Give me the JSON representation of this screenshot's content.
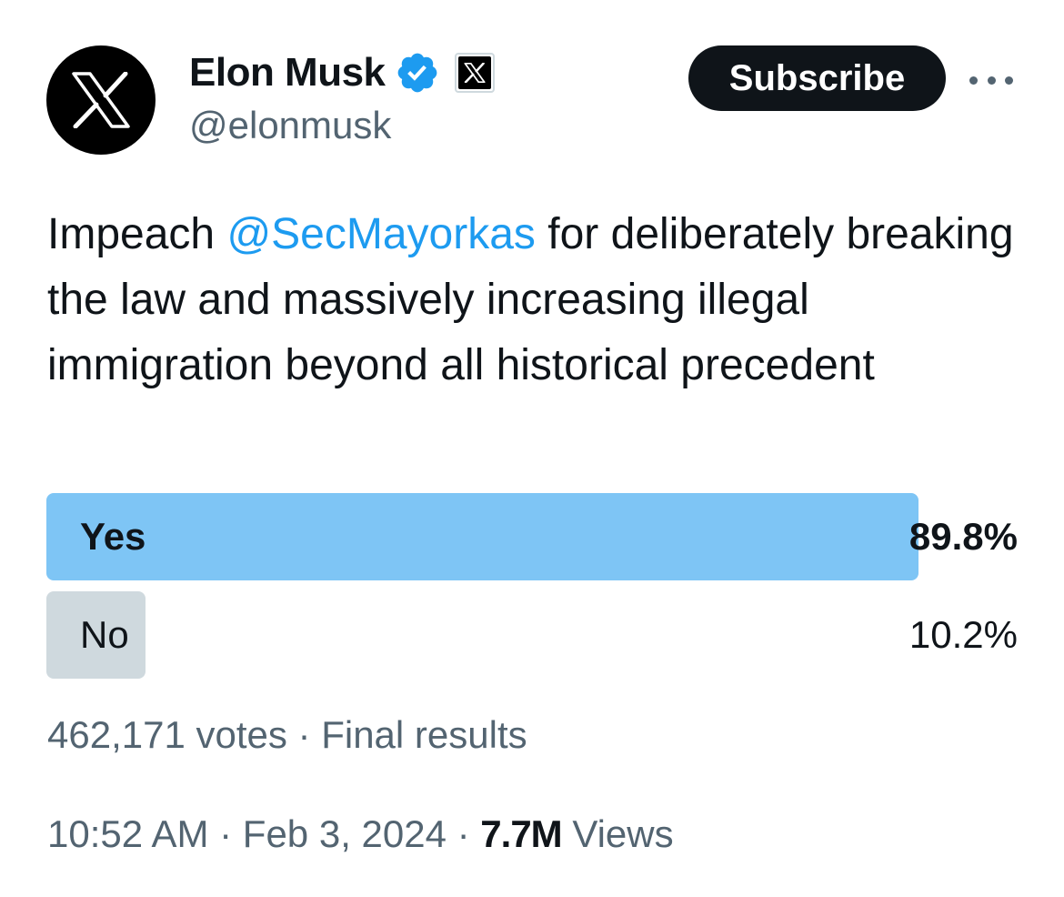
{
  "author": {
    "display_name": "Elon Musk",
    "handle": "@elonmusk",
    "avatar_icon": "x-logo-icon",
    "verified_icon": "verified-badge-icon",
    "affiliation_icon": "x-affiliate-badge-icon"
  },
  "actions": {
    "subscribe_label": "Subscribe",
    "more_icon": "more-dots-icon"
  },
  "tweet": {
    "text_before": "Impeach ",
    "mention": "@SecMayorkas",
    "text_after": " for deliberately breaking the law and massively increasing illegal immigration beyond all historical precedent"
  },
  "poll": {
    "options": [
      {
        "label": "Yes",
        "percent_label": "89.8%",
        "percent": 89.8,
        "winner": true
      },
      {
        "label": "No",
        "percent_label": "10.2%",
        "percent": 10.2,
        "winner": false
      }
    ],
    "votes": "462,171 votes",
    "separator": " · ",
    "status": "Final results"
  },
  "footer": {
    "time": "10:52 AM",
    "separator": " · ",
    "date": "Feb 3, 2024",
    "views_count": "7.7M",
    "views_label": " Views"
  },
  "colors": {
    "accent": "#1d9bf0",
    "winner_fill": "#7ec5f5",
    "other_fill": "#cfd9de",
    "muted_text": "#536471"
  }
}
